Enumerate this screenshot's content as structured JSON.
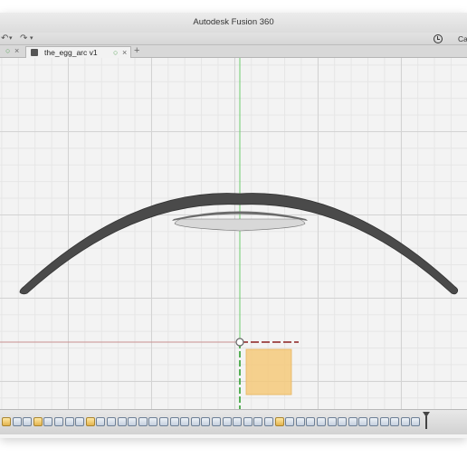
{
  "window": {
    "title": "Autodesk Fusion 360"
  },
  "toolbar": {
    "cancel_label": "Ca"
  },
  "tabs": [
    {
      "label": "the_egg_arc v1"
    }
  ],
  "icons": {
    "clock": "clock-icon",
    "document": "document-icon",
    "new_tab": "plus-icon",
    "undo": "undo-icon",
    "redo": "redo-icon"
  },
  "colors": {
    "green_axis": "#5cc85c",
    "red_axis": "#b23a3a",
    "arc_body": "#4b4b4b",
    "selected_face": "#f5c97a"
  },
  "timeline": {
    "features": [
      "sketch",
      "body",
      "body",
      "sketch",
      "body",
      "body",
      "body",
      "body",
      "sketch",
      "body",
      "body",
      "body",
      "body",
      "body",
      "body",
      "body",
      "body",
      "body",
      "body",
      "body",
      "body",
      "body",
      "body",
      "body",
      "body",
      "body",
      "sketch",
      "body",
      "body",
      "body",
      "body",
      "body",
      "body",
      "body",
      "body",
      "body",
      "body",
      "body",
      "body",
      "body"
    ]
  }
}
